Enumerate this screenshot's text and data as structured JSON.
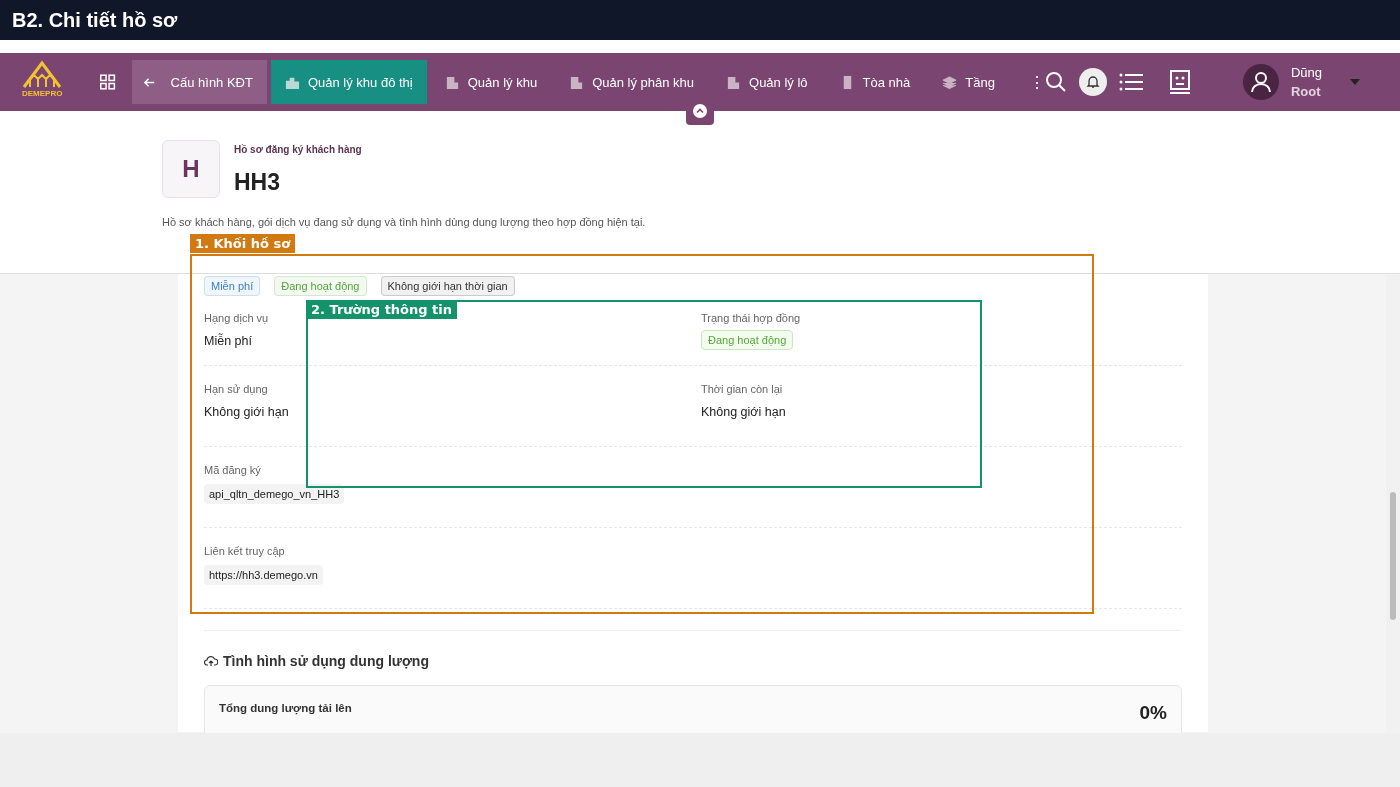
{
  "caption": "B2. Chi tiết hồ sơ",
  "navbar": {
    "logo_text": "DEMEPRO",
    "items": [
      {
        "label": "Cấu hình KĐT",
        "kind": "back",
        "selected": false
      },
      {
        "label": "Quản lý khu đô thị",
        "kind": "city",
        "selected": true
      },
      {
        "label": "Quản lý khu",
        "kind": "building",
        "selected": false
      },
      {
        "label": "Quản lý phân khu",
        "kind": "building",
        "selected": false
      },
      {
        "label": "Quản lý lô",
        "kind": "building",
        "selected": false
      },
      {
        "label": "Tòa nhà",
        "kind": "tower",
        "selected": false
      },
      {
        "label": "Tầng",
        "kind": "layers",
        "selected": false
      }
    ],
    "more": "⋮",
    "user": {
      "name": "Dũng",
      "role": "Root"
    }
  },
  "header": {
    "avatar_letter": "H",
    "subtitle": "Hồ sơ đăng ký khách hàng",
    "title": "HH3",
    "description": "Hồ sơ khách hàng, gói dịch vụ đang sử dụng và tình hình dùng dung lượng theo hợp đồng hiện tại."
  },
  "tags": [
    {
      "label": "Miễn phí",
      "color": "#3b82c4"
    },
    {
      "label": "Đang hoạt động",
      "color": "#52a83a"
    },
    {
      "label": "Không giới hạn thời gian",
      "color": "#333333"
    }
  ],
  "field_rows": [
    [
      {
        "label": "Hạng dịch vụ",
        "value": "Miễn phí",
        "kind": "text"
      },
      {
        "label": "Trạng thái hợp đồng",
        "value": "Đang hoạt động",
        "kind": "tag"
      }
    ],
    [
      {
        "label": "Hạn sử dụng",
        "value": "Không giới hạn",
        "kind": "text"
      },
      {
        "label": "Thời gian còn lại",
        "value": "Không giới hạn",
        "kind": "text"
      }
    ],
    [
      {
        "label": "Mã đăng ký",
        "value": "api_qltn_demego_vn_HH3",
        "kind": "code"
      }
    ],
    [
      {
        "label": "Liên kết truy cập",
        "value": "https://hh3.demego.vn",
        "kind": "code"
      }
    ]
  ],
  "usage": {
    "title": "Tình hình sử dụng dung lượng",
    "rows": [
      {
        "label": "Tổng dung lượng tải lên",
        "value": "0%"
      }
    ]
  },
  "annotations": [
    {
      "label": "1. Khối hồ sơ",
      "color": "#d17a12"
    },
    {
      "label": "2. Trường thông tin",
      "color": "#14936b"
    }
  ]
}
